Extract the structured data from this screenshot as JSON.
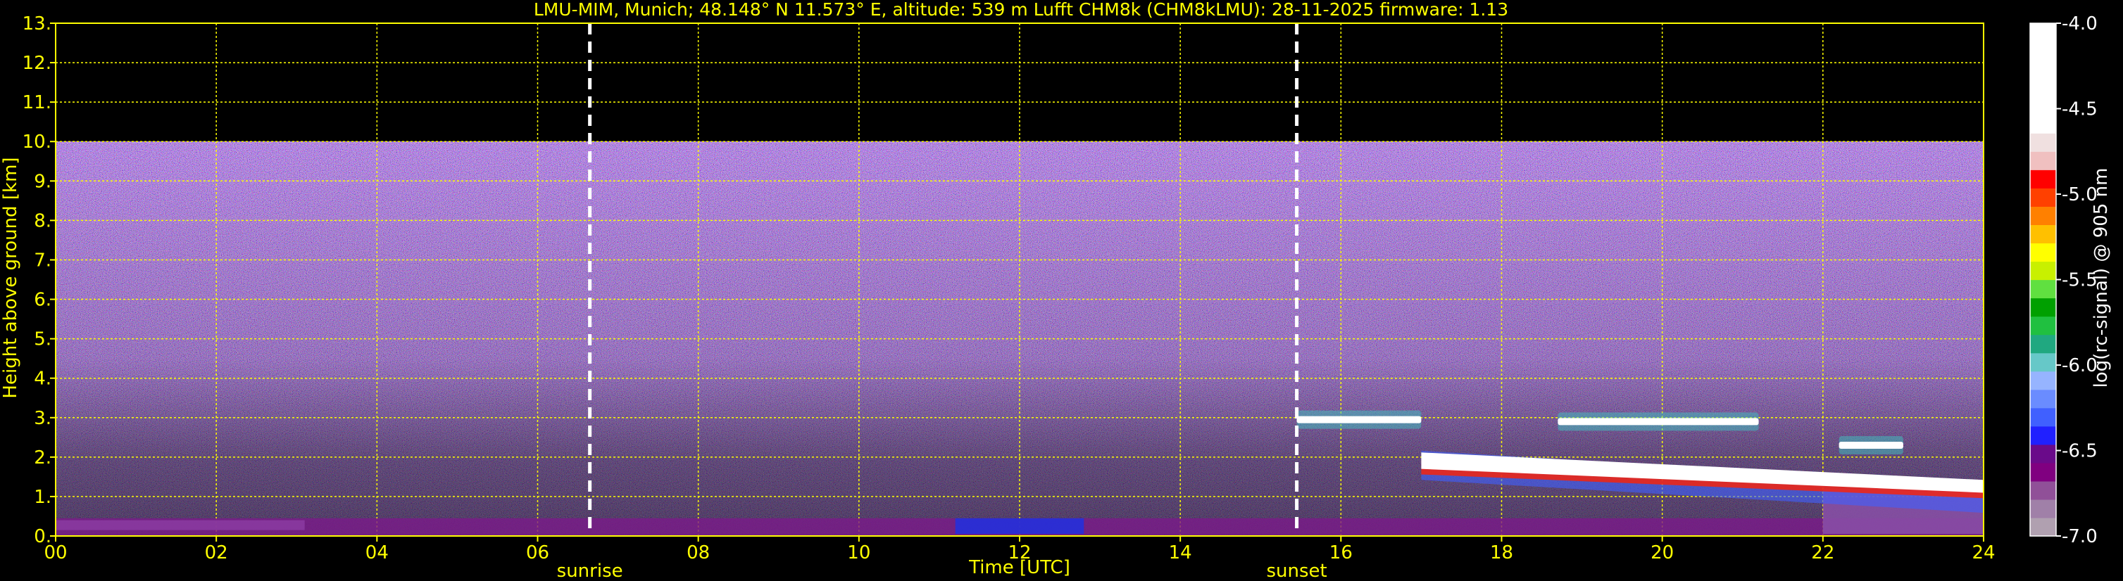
{
  "chart_data": {
    "type": "heatmap",
    "title": "LMU-MIM, Munich; 48.148° N 11.573° E, altitude: 539 m    Lufft CHM8k (CHM8kLMU): 28-11-2025    firmware: 1.13",
    "xlabel": "Time [UTC]",
    "ylabel": "Height above ground [km]",
    "xlim": [
      0,
      24
    ],
    "ylim": [
      0,
      13
    ],
    "x_ticks": [
      "00",
      "02",
      "04",
      "06",
      "08",
      "10",
      "12",
      "14",
      "16",
      "18",
      "20",
      "22",
      "24"
    ],
    "y_ticks": [
      "0.",
      "1.",
      "2.",
      "3.",
      "4.",
      "5.",
      "6.",
      "7.",
      "8.",
      "9.",
      "10.",
      "11.",
      "12.",
      "13."
    ],
    "grid": true,
    "colorbar": {
      "label": "log(rc-signal) @ 905 nm",
      "range": [
        -7.0,
        -4.0
      ],
      "ticks": [
        "-4.0",
        "-4.5",
        "-5.0",
        "-5.5",
        "-6.0",
        "-6.5",
        "-7.0"
      ],
      "colors": [
        "#b0a0b0",
        "#a080a8",
        "#905098",
        "#800080",
        "#6a0a8a",
        "#2020ff",
        "#4060ff",
        "#6a8cff",
        "#96b4ff",
        "#66c8c8",
        "#20a880",
        "#20c040",
        "#00a000",
        "#60e040",
        "#c8f000",
        "#ffff00",
        "#ffc000",
        "#ff8000",
        "#ff4000",
        "#ff0000",
        "#f0c0c0",
        "#f0e0e0",
        "#ffffff",
        "#ffffff",
        "#ffffff",
        "#ffffff",
        "#ffffff",
        "#ffffff"
      ]
    },
    "signal_top_km": 10.0,
    "annotations": [
      {
        "label": "sunrise",
        "x": 6.65
      },
      {
        "label": "sunset",
        "x": 15.45
      }
    ],
    "cloud_layers": [
      {
        "x_start": 15.45,
        "x_end": 17.0,
        "height_km": 2.95
      },
      {
        "x_start": 18.7,
        "x_end": 21.2,
        "height_km": 2.9
      },
      {
        "x_start": 17.0,
        "x_end": 24.0,
        "height_km": 1.7
      },
      {
        "x_start": 22.2,
        "x_end": 23.0,
        "height_km": 2.3
      }
    ]
  }
}
